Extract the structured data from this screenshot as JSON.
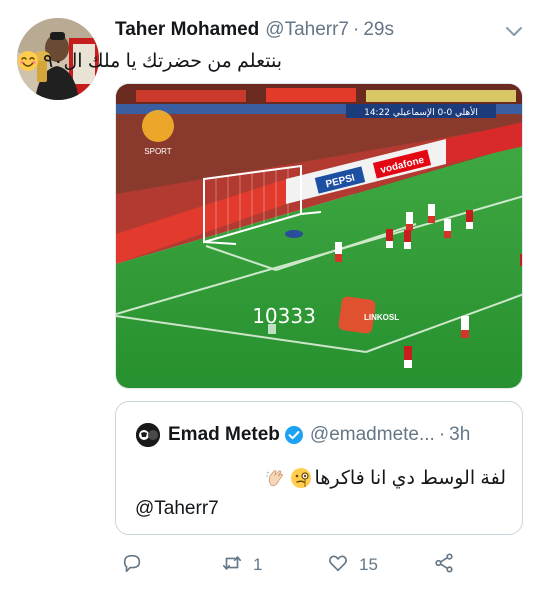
{
  "tweet": {
    "author_name": "Taher Mohamed",
    "author_handle": "@Taherr7",
    "separator": "·",
    "time": "29s",
    "text": "بنتعلم من حضرتك يا ملك ال٩٠",
    "emoji": "smiling-face-icon",
    "media": {
      "scoreboard": "الأهلي 0-0 الإسماعيلي 14:22",
      "watermark_counter": "10333",
      "watermark_logo": "LINKOSL",
      "sponsor_banners": [
        "vodafone",
        "PEPSI"
      ],
      "channel_logo": "SPORT"
    }
  },
  "quoted": {
    "author_name": "Emad Meteb",
    "author_handle": "@emadmete...",
    "separator": "·",
    "time": "3h",
    "text": "لفة الوسط دي انا فاكرها",
    "emojis": [
      "clapping-hands-icon",
      "face-with-monocle-icon"
    ],
    "mention": "@Taherr7"
  },
  "actions": {
    "reply_count": "",
    "retweet_count": "1",
    "like_count": "15"
  },
  "colors": {
    "text": "#14171a",
    "secondary": "#657786",
    "border": "#ccd6dd",
    "verified": "#1da1f2",
    "pitch": "#2f9a38"
  }
}
